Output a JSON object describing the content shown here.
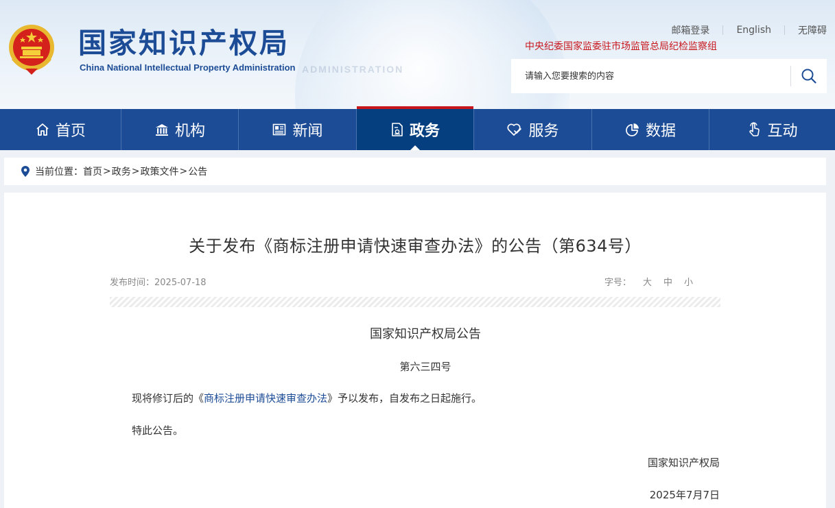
{
  "header": {
    "site_title_cn": "国家知识产权局",
    "site_title_en": "China National Intellectual Property Administration",
    "watermark": "ADMINISTRATION",
    "top_links": [
      "邮箱登录",
      "English",
      "无障碍"
    ],
    "discipline_link": "中央纪委国家监委驻市场监管总局纪检监察组",
    "search": {
      "placeholder": "请输入您要搜索的内容"
    },
    "emblem_icon": "national-emblem-icon"
  },
  "nav": {
    "items": [
      {
        "label": "首页",
        "icon": "home-icon"
      },
      {
        "label": "机构",
        "icon": "building-icon"
      },
      {
        "label": "新闻",
        "icon": "newspaper-icon"
      },
      {
        "label": "政务",
        "icon": "document-icon",
        "active": true
      },
      {
        "label": "服务",
        "icon": "heart-hand-icon"
      },
      {
        "label": "数据",
        "icon": "pie-chart-icon"
      },
      {
        "label": "互动",
        "icon": "pointer-hand-icon"
      }
    ]
  },
  "breadcrumb": {
    "prefix": "当前位置：",
    "items": [
      "首页",
      "政务",
      "政策文件",
      "公告"
    ],
    "separator": ">"
  },
  "article": {
    "title": "关于发布《商标注册申请快速审查办法》的公告（第634号）",
    "publish_label": "发布时间：",
    "publish_date": "2025-07-18",
    "font_size_label": "字号：",
    "font_sizes": [
      "大",
      "中",
      "小"
    ],
    "issuer": "国家知识产权局公告",
    "number": "第六三四号",
    "para1_before": "现将修订后的《",
    "para1_link": "商标注册申请快速审查办法",
    "para1_after": "》予以发布，自发布之日起施行。",
    "para2": "特此公告。",
    "signature": "国家知识产权局",
    "sign_date": "2025年7月7日"
  },
  "colors": {
    "brand_blue": "#1d4c96",
    "active_nav": "#063f7f",
    "accent_red": "#c8161d",
    "page_bg": "#eef1f5"
  }
}
